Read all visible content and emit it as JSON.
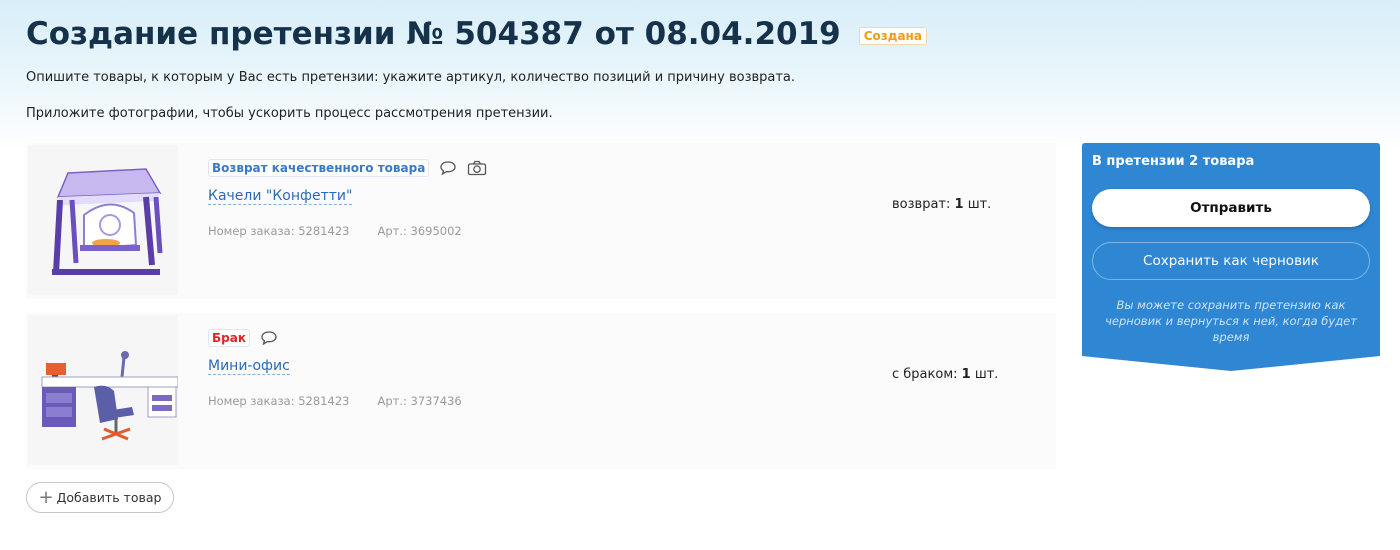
{
  "header": {
    "title": "Создание претензии № 504387 от 08.04.2019",
    "status": "Создана",
    "hint1": "Опишите товары, к которым у Вас есть претензии: укажите артикул, количество позиций и причину возврата.",
    "hint2": "Приложите фотографии, чтобы ускорить процесс рассмотрения претензии."
  },
  "items": [
    {
      "reason": "Возврат качественного товара",
      "name": "Качели \"Конфетти\"",
      "order": "Номер заказа: 5281423",
      "article": "Арт.: 3695002",
      "qty_label": "возврат:",
      "qty_value": "1",
      "qty_unit": "шт.",
      "icons": [
        "comment-icon",
        "camera-icon"
      ]
    },
    {
      "reason": "Брак",
      "name": "Мини-офис",
      "order": "Номер заказа: 5281423",
      "article": "Арт.: 3737436",
      "qty_label": "с браком:",
      "qty_value": "1",
      "qty_unit": "шт.",
      "icons": [
        "comment-icon"
      ]
    }
  ],
  "add_button": {
    "icon": "plus-icon",
    "label": "Добавить товар"
  },
  "panel": {
    "title": "В претензии 2 товара",
    "send_label": "Отправить",
    "draft_label": "Сохранить как черновик",
    "note": "Вы можете сохранить претензию как черновик и вернуться к ней, когда будет время"
  },
  "colors": {
    "title": "#15324a",
    "status": "#f29b12",
    "panel": "#2f86d3",
    "link": "#2a6ab8",
    "defect": "#e02525"
  }
}
